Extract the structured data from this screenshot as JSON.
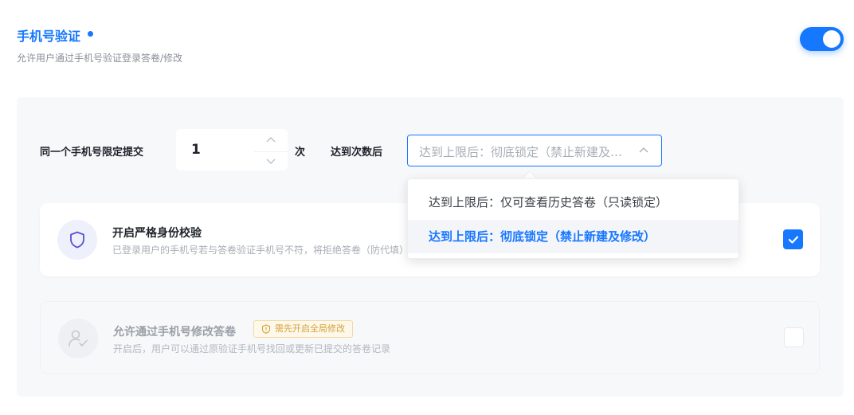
{
  "header": {
    "title": "手机号验证",
    "description": "允许用户通过手机号验证登录答卷/修改",
    "toggle_on": true
  },
  "limit_row": {
    "label": "同一个手机号限定提交",
    "value": "1",
    "unit": "次",
    "after_label": "达到次数后",
    "select_value": "达到上限后：彻底锁定（禁止新建及修改）"
  },
  "dropdown": {
    "options": [
      {
        "label": "达到上限后：仅可查看历史答卷（只读锁定）",
        "selected": false
      },
      {
        "label": "达到上限后：彻底锁定（禁止新建及修改）",
        "selected": true
      }
    ]
  },
  "cards": [
    {
      "title": "开启严格身份校验",
      "description": "已登录用户的手机号若与答卷验证手机号不符，将拒绝答卷（防代填）",
      "checked": true,
      "icon": "shield-icon"
    },
    {
      "title": "允许通过手机号修改答卷",
      "badge": "需先开启全局修改",
      "description": "开启后，用户可以通过原验证手机号找回或更新已提交的答卷记录",
      "checked": false,
      "disabled": true,
      "icon": "user-check-icon"
    }
  ],
  "colors": {
    "accent": "#1677ff",
    "badge_text": "#d4a23a",
    "badge_bg": "#fdf8ea"
  }
}
